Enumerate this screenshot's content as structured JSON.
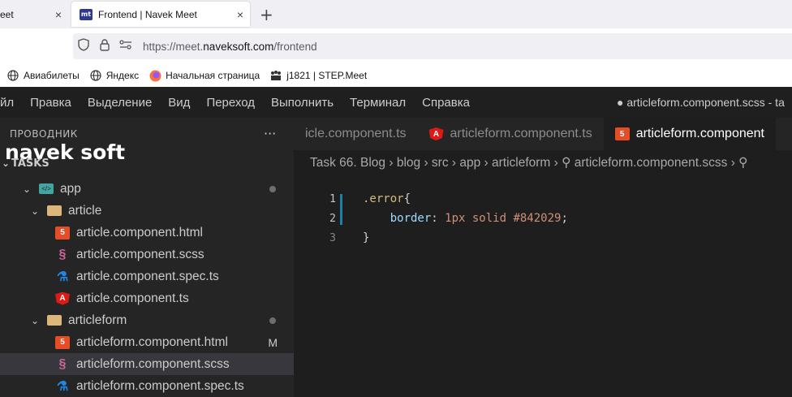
{
  "browser": {
    "tabs": [
      {
        "label": "eet",
        "active": false
      },
      {
        "label": "Frontend | Navek Meet",
        "active": true,
        "favicon": "mt"
      }
    ],
    "new_tab": "+",
    "close": "×",
    "url": {
      "scheme": "https://meet.",
      "host": "naveksoft.com",
      "path": "/frontend"
    },
    "bookmarks": [
      {
        "label": "Авиабилеты",
        "icon": "globe-icon"
      },
      {
        "label": "Яндекс",
        "icon": "globe-icon"
      },
      {
        "label": "Начальная страница",
        "icon": "firefox-icon"
      },
      {
        "label": "j1821 | STEP.Meet",
        "icon": "people-icon"
      }
    ]
  },
  "vscode": {
    "menu": [
      "йл",
      "Правка",
      "Выделение",
      "Вид",
      "Переход",
      "Выполнить",
      "Терминал",
      "Справка"
    ],
    "window_title": "● articleform.component.scss - ta",
    "logo": "navek soft",
    "explorer_title": "ПРОВОДНИК",
    "more": "···",
    "section": "TASKS",
    "tree": [
      {
        "label": "app",
        "type": "app-folder",
        "indent": 1,
        "marker": "dot"
      },
      {
        "label": "article",
        "type": "folder",
        "indent": 2
      },
      {
        "label": "article.component.html",
        "type": "html",
        "indent": 3
      },
      {
        "label": "article.component.scss",
        "type": "scss",
        "indent": 3
      },
      {
        "label": "article.component.spec.ts",
        "type": "spec",
        "indent": 3
      },
      {
        "label": "article.component.ts",
        "type": "ts",
        "indent": 3
      },
      {
        "label": "articleform",
        "type": "folder",
        "indent": 2,
        "marker": "dot"
      },
      {
        "label": "articleform.component.html",
        "type": "html",
        "indent": 3,
        "marker": "M"
      },
      {
        "label": "articleform.component.scss",
        "type": "scss",
        "indent": 3,
        "selected": true
      },
      {
        "label": "articleform.component.spec.ts",
        "type": "spec",
        "indent": 3
      }
    ],
    "editor_tabs": [
      {
        "label": "icle.component.ts",
        "icon": ""
      },
      {
        "label": "articleform.component.ts",
        "icon": "ts"
      },
      {
        "label": "articleform.component",
        "icon": "html",
        "active": true
      }
    ],
    "breadcrumb": "Task 66. Blog › blog › src › app › articleform › ⚲ articleform.component.scss › ⚲",
    "code": [
      {
        "n": "1",
        "parts": [
          {
            "t": ".error",
            "c": "sel"
          },
          {
            "t": "{",
            "c": "punc"
          }
        ]
      },
      {
        "n": "2",
        "parts": [
          {
            "t": "    border",
            "c": "prop"
          },
          {
            "t": ": ",
            "c": "punc"
          },
          {
            "t": "1px solid #842029",
            "c": "val"
          },
          {
            "t": ";",
            "c": "punc"
          }
        ]
      },
      {
        "n": "3",
        "parts": [
          {
            "t": "}",
            "c": "punc"
          }
        ]
      }
    ]
  }
}
